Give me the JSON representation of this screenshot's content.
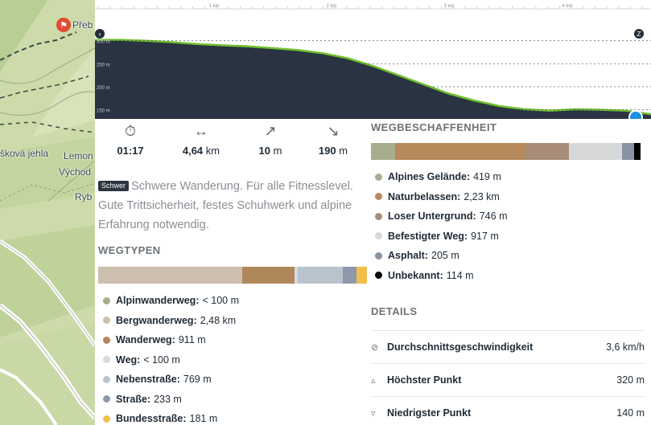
{
  "map": {
    "poi_label": "Přeb",
    "labels": [
      "šková jehla",
      "Lemon",
      "Východ",
      "Ryb"
    ]
  },
  "profile": {
    "distance_ticks": [
      "1 km",
      "2 km",
      "3 km",
      "4 km"
    ],
    "elevation_ticks": [
      "300 m",
      "250 m",
      "200 m",
      "150 m"
    ],
    "start_marker": "›",
    "end_marker": "Z",
    "elevation_profile_m": [
      302,
      302,
      300,
      297,
      293,
      290,
      288,
      284,
      280,
      273,
      262,
      245,
      225,
      205,
      185,
      170,
      158,
      151,
      148,
      151,
      150,
      148,
      140
    ],
    "colors": {
      "fill": "#2a3342",
      "line": "#6fbf2e"
    }
  },
  "stats": {
    "duration": {
      "icon": "stopwatch-icon",
      "value": "01:17"
    },
    "distance": {
      "icon": "horizontal-arrows-icon",
      "value": "4,64",
      "unit": "km"
    },
    "ascent": {
      "icon": "arrow-up-right-icon",
      "value": "10",
      "unit": "m"
    },
    "descent": {
      "icon": "arrow-down-right-icon",
      "value": "190",
      "unit": "m"
    }
  },
  "description": {
    "badge": "Schwer",
    "text": "Schwere Wanderung. Für alle Fitnesslevel. Gute Trittsicherheit, festes Schuhwerk und alpine Erfahrung notwendig."
  },
  "wegtypen": {
    "title": "WEGTYPEN",
    "items": [
      {
        "label": "Alpinwanderweg:",
        "value": "< 100 m",
        "color": "#a7ad8d",
        "share": 0.0
      },
      {
        "label": "Bergwanderweg:",
        "value": "2,48 km",
        "color": "#cdbfad",
        "share": 0.545
      },
      {
        "label": "Wanderweg:",
        "value": "911 m",
        "color": "#b0875a",
        "share": 0.2
      },
      {
        "label": "Weg:",
        "value": "< 100 m",
        "color": "#d4dbe1",
        "share": 0.012
      },
      {
        "label": "Nebenstraße:",
        "value": "769 m",
        "color": "#b9c3cd",
        "share": 0.17
      },
      {
        "label": "Straße:",
        "value": "233 m",
        "color": "#8d99aa",
        "share": 0.052
      },
      {
        "label": "Bundesstraße:",
        "value": "181 m",
        "color": "#f0bf4a",
        "share": 0.04
      }
    ]
  },
  "wegbeschaffenheit": {
    "title": "WEGBESCHAFFENHEIT",
    "items": [
      {
        "label": "Alpines Gelände:",
        "value": "419 m",
        "color": "#a7ad8d",
        "share": 0.09
      },
      {
        "label": "Naturbelassen:",
        "value": "2,23 km",
        "color": "#b5895a",
        "share": 0.48
      },
      {
        "label": "Loser Untergrund:",
        "value": "746 m",
        "color": "#a88c78",
        "share": 0.161
      },
      {
        "label": "Befestigter Weg:",
        "value": "917 m",
        "color": "#d6d8da",
        "share": 0.198
      },
      {
        "label": "Asphalt:",
        "value": "205 m",
        "color": "#8893a2",
        "share": 0.044
      },
      {
        "label": "Unbekannt:",
        "value": "114 m",
        "color": "#000000",
        "share": 0.025
      }
    ]
  },
  "details": {
    "title": "DETAILS",
    "rows": [
      {
        "icon": "speed-icon",
        "glyph": "⊘",
        "label": "Durchschnittsgeschwindigkeit",
        "value": "3,6 km/h"
      },
      {
        "icon": "triangle-up-icon",
        "glyph": "▵",
        "label": "Höchster Punkt",
        "value": "320 m"
      },
      {
        "icon": "triangle-down-icon",
        "glyph": "▿",
        "label": "Niedrigster Punkt",
        "value": "140 m"
      }
    ]
  }
}
